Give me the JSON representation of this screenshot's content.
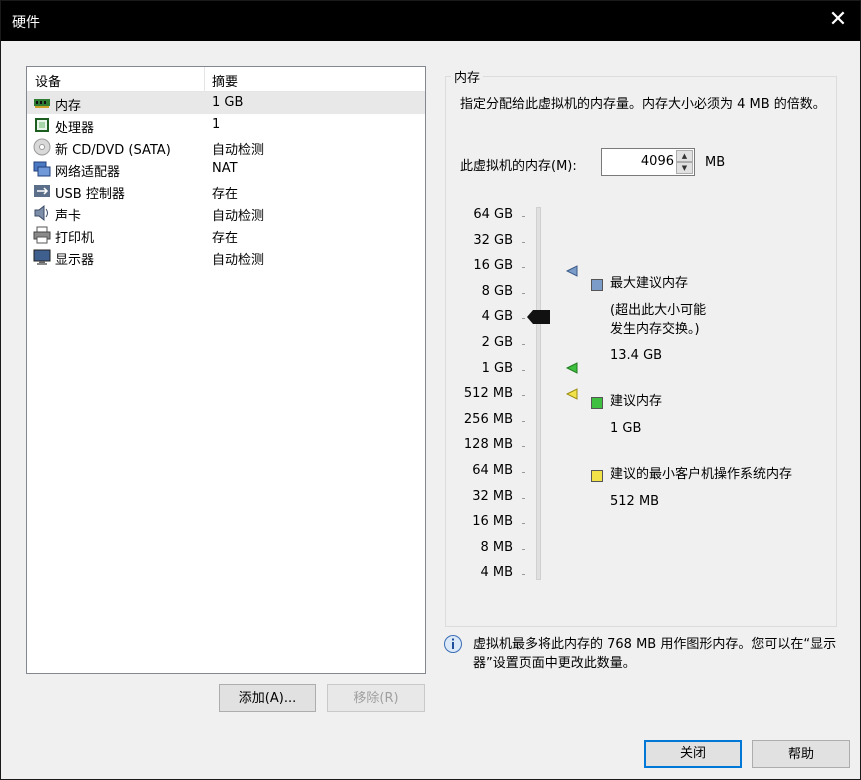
{
  "window": {
    "title": "硬件",
    "close_glyph": "✕"
  },
  "devices": {
    "header": {
      "device": "设备",
      "summary": "摘要"
    },
    "items": [
      {
        "icon": "memory-icon",
        "name": "内存",
        "summary": "1 GB",
        "selected": true
      },
      {
        "icon": "processor-icon",
        "name": "处理器",
        "summary": "1"
      },
      {
        "icon": "cd-dvd-icon",
        "name": "新 CD/DVD (SATA)",
        "summary": "自动检测"
      },
      {
        "icon": "network-adapter-icon",
        "name": "网络适配器",
        "summary": "NAT"
      },
      {
        "icon": "usb-icon",
        "name": "USB 控制器",
        "summary": "存在"
      },
      {
        "icon": "sound-card-icon",
        "name": "声卡",
        "summary": "自动检测"
      },
      {
        "icon": "printer-icon",
        "name": "打印机",
        "summary": "存在"
      },
      {
        "icon": "display-icon",
        "name": "显示器",
        "summary": "自动检测"
      }
    ],
    "add_button": "添加(A)...",
    "remove_button": "移除(R)"
  },
  "memory": {
    "group_title": "内存",
    "description": "指定分配给此虚拟机的内存量。内存大小必须为 4 MB 的倍数。",
    "field_label": "此虚拟机的内存(M):",
    "value": "4096",
    "unit": "MB",
    "slider_ticks": [
      "64 GB",
      "32 GB",
      "16 GB",
      "8 GB",
      "4 GB",
      "2 GB",
      "1 GB",
      "512 MB",
      "256 MB",
      "128 MB",
      "64 MB",
      "32 MB",
      "16 MB",
      "8 MB",
      "4 MB"
    ],
    "slider_value": "4 GB",
    "legend": {
      "max": {
        "label": "最大建议内存",
        "note_line1": "(超出此大小可能",
        "note_line2": "发生内存交换。)",
        "value": "13.4 GB",
        "color": "#7b9cc8"
      },
      "recommended": {
        "label": "建议内存",
        "value": "1 GB",
        "color": "#3fbf3f"
      },
      "minimum": {
        "label": "建议的最小客户机操作系统内存",
        "value": "512 MB",
        "color": "#f2e24a"
      }
    },
    "note": "虚拟机最多将此内存的 768 MB 用作图形内存。您可以在“显示器”设置页面中更改此数量。"
  },
  "footer": {
    "close_button": "关闭",
    "help_button": "帮助"
  }
}
